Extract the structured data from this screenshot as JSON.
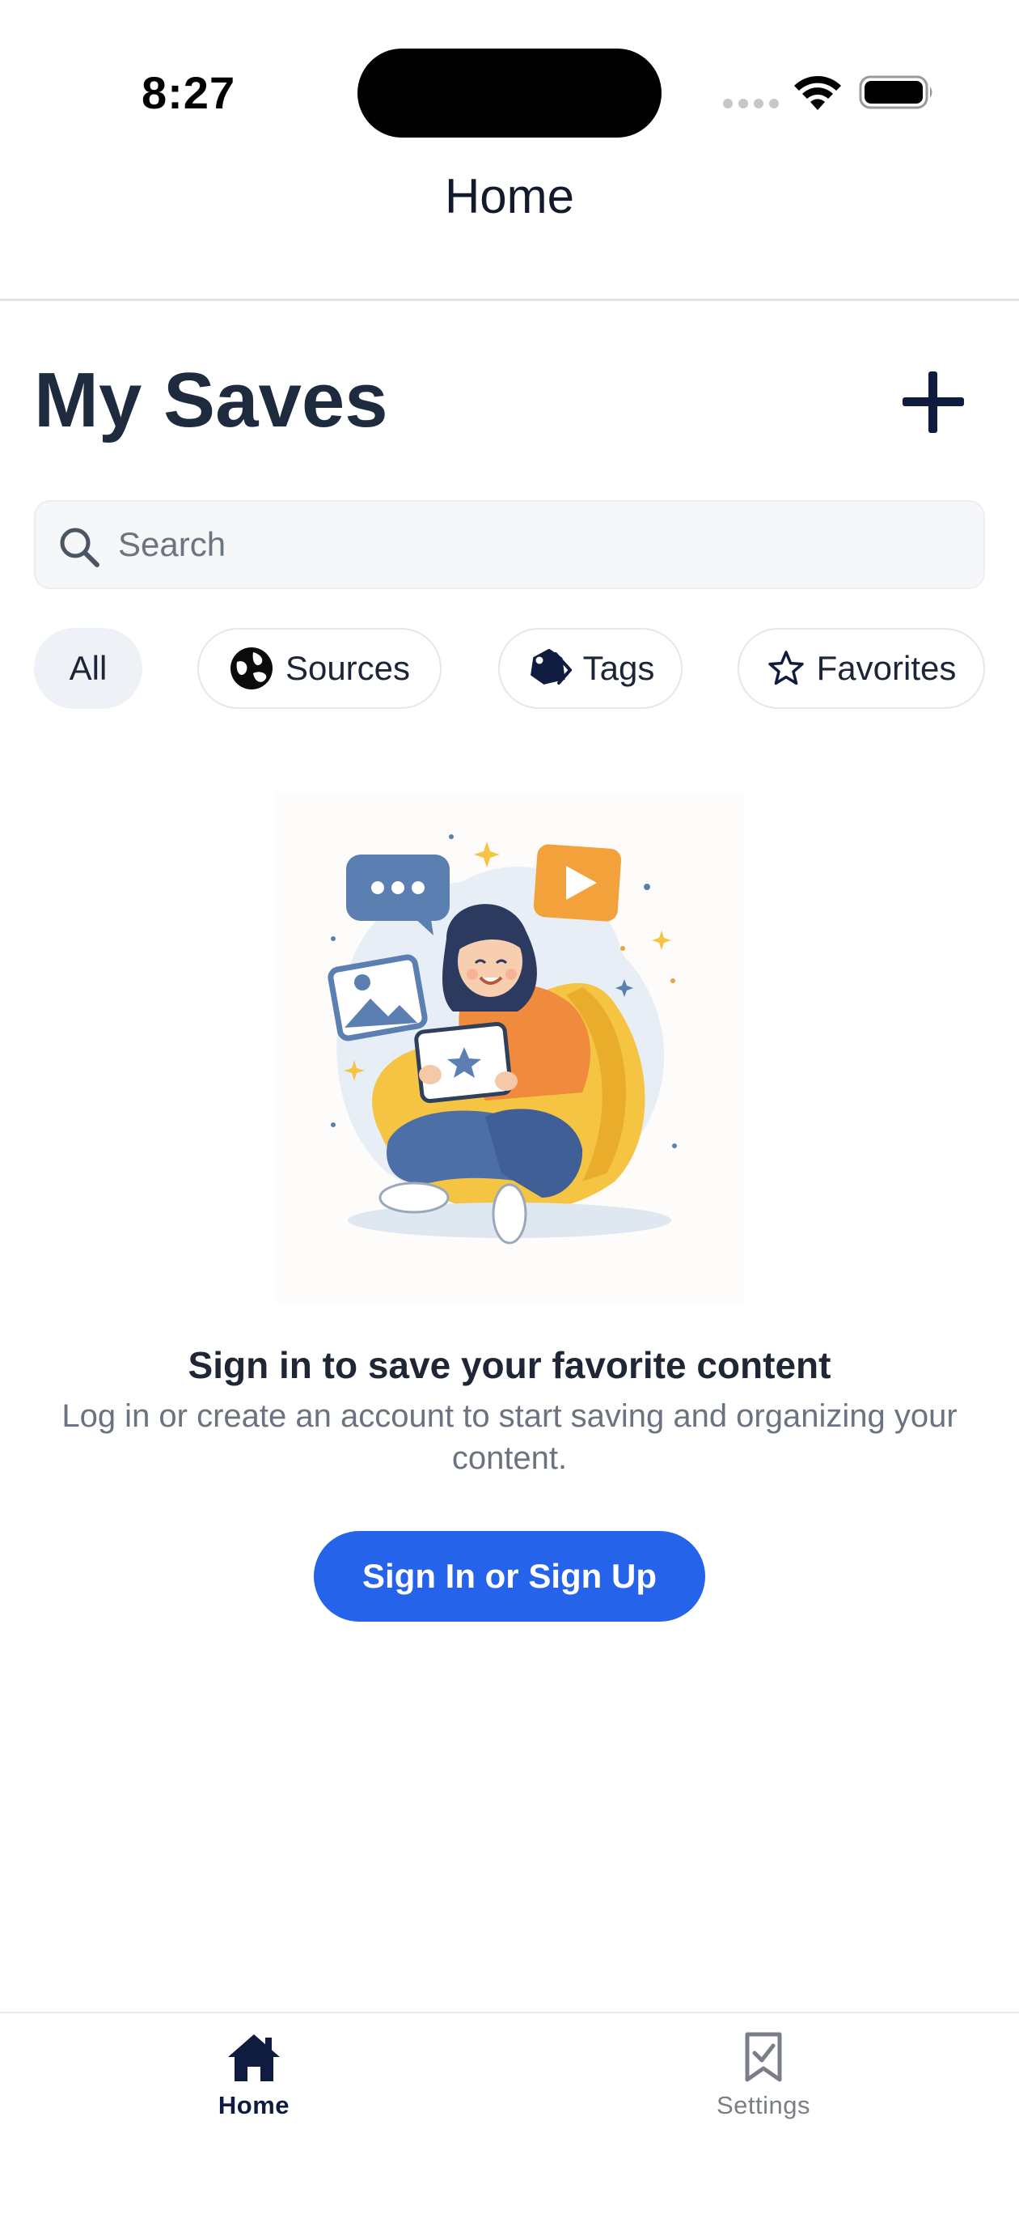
{
  "status_bar": {
    "time": "8:27"
  },
  "header": {
    "title": "Home"
  },
  "main": {
    "title": "My Saves",
    "search": {
      "placeholder": "Search",
      "value": ""
    },
    "filters": [
      {
        "label": "All",
        "icon": "none",
        "selected": true
      },
      {
        "label": "Sources",
        "icon": "globe-icon",
        "selected": false
      },
      {
        "label": "Tags",
        "icon": "tag-icon",
        "selected": false
      },
      {
        "label": "Favorites",
        "icon": "star-icon",
        "selected": false
      }
    ],
    "empty_state": {
      "title": "Sign in to save your favorite content",
      "body": "Log in or create an account to start saving and organizing your content.",
      "button_label": "Sign In or Sign Up"
    }
  },
  "tab_bar": {
    "tabs": [
      {
        "label": "Home",
        "icon": "home-icon",
        "active": true
      },
      {
        "label": "Settings",
        "icon": "bookmark-check-icon",
        "active": false
      }
    ]
  },
  "colors": {
    "accent": "#2563eb",
    "navy": "#0f1c40",
    "title_text": "#1e2a3e",
    "muted_text": "#6b7280"
  }
}
